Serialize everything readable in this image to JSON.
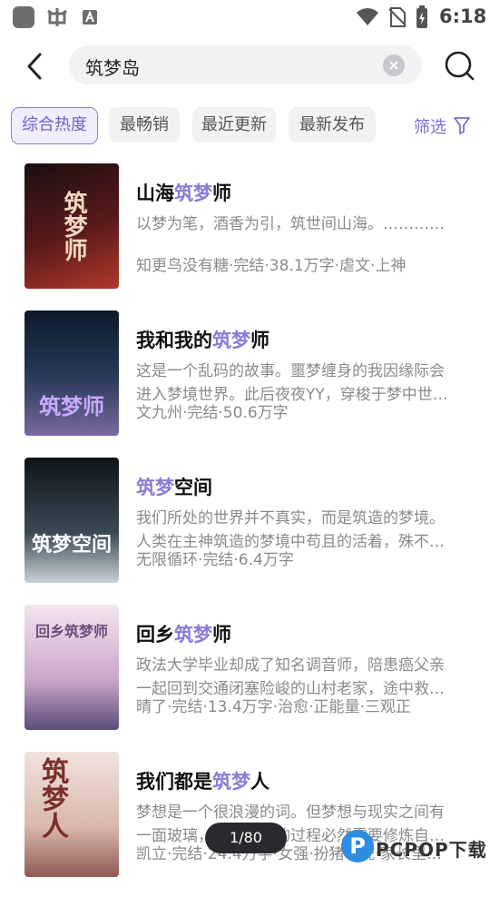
{
  "status_bar": {
    "time": "6:18",
    "icons": [
      "app-square-icon",
      "bug-icon",
      "a-badge-icon",
      "wifi-icon",
      "no-sim-icon",
      "battery-charging-icon"
    ]
  },
  "header": {
    "search_query": "筑梦岛",
    "back_icon": "back-chevron-icon",
    "clear_icon": "clear-icon",
    "search_icon": "search-icon"
  },
  "sort_bar": {
    "chips": [
      {
        "label": "综合热度",
        "active": true
      },
      {
        "label": "最畅销",
        "active": false
      },
      {
        "label": "最近更新",
        "active": false
      },
      {
        "label": "最新发布",
        "active": false
      }
    ],
    "filter_label": "筛选",
    "filter_icon": "funnel-icon"
  },
  "books": [
    {
      "title_pre": "山海",
      "title_hl": "筑梦",
      "title_post": "师",
      "desc_line1": "以梦为笔，酒香为引，筑世间山海。…………",
      "desc_line2": "",
      "meta": "知更鸟没有糖·完结·38.1万字·虐文·上神",
      "cover_text": "筑梦师",
      "cover_colors": [
        "#1a0f10",
        "#5a1a1c",
        "#b03a2a"
      ]
    },
    {
      "title_pre": "我和我的",
      "title_hl": "筑梦",
      "title_post": "师",
      "desc_line1": "这是一个乱码的故事。噩梦缠身的我因缘际会",
      "desc_line2": "进入梦境世界。此后夜夜YY，穿梭于梦中世…",
      "meta": "文九州·完结·50.6万字",
      "cover_text": "筑梦师",
      "cover_colors": [
        "#0d1a2a",
        "#2b3b5a",
        "#7a6aa0"
      ]
    },
    {
      "title_pre": "",
      "title_hl": "筑梦",
      "title_post": "空间",
      "desc_line1": "我们所处的世界并不真实，而是筑造的梦境。",
      "desc_line2": "人类在主神筑造的梦境中苟且的活着，殊不…",
      "meta": "无限循环·完结·6.4万字",
      "cover_text": "筑梦空间",
      "cover_colors": [
        "#0e1418",
        "#3a4a55",
        "#c9d2d8"
      ]
    },
    {
      "title_pre": "回乡",
      "title_hl": "筑梦",
      "title_post": "师",
      "desc_line1": "政法大学毕业却成了知名调音师，陪患癌父亲",
      "desc_line2": "一起回到交通闭塞险峻的山村老家，途中救…",
      "meta": "晴了·完结·13.4万字·治愈·正能量·三观正",
      "cover_text": "回乡筑梦师",
      "cover_colors": [
        "#f3e6ee",
        "#c9a6c8",
        "#5a4b7a"
      ]
    },
    {
      "title_pre": "我们都是",
      "title_hl": "筑梦",
      "title_post": "人",
      "desc_line1": "梦想是一个很浪漫的词。但梦想与现实之间有",
      "desc_line2": "一面玻璃，打破这面的过程必然需要修炼自…",
      "meta": "凯立·完结·24.4万字·女强·扮猪吃虎·家长里…",
      "cover_text": "筑梦人",
      "cover_colors": [
        "#f1e3dd",
        "#d8b7ae",
        "#8e5a52"
      ]
    }
  ],
  "pager": "1/80",
  "watermark": {
    "letter": "P",
    "text": "PCPOP下载"
  }
}
